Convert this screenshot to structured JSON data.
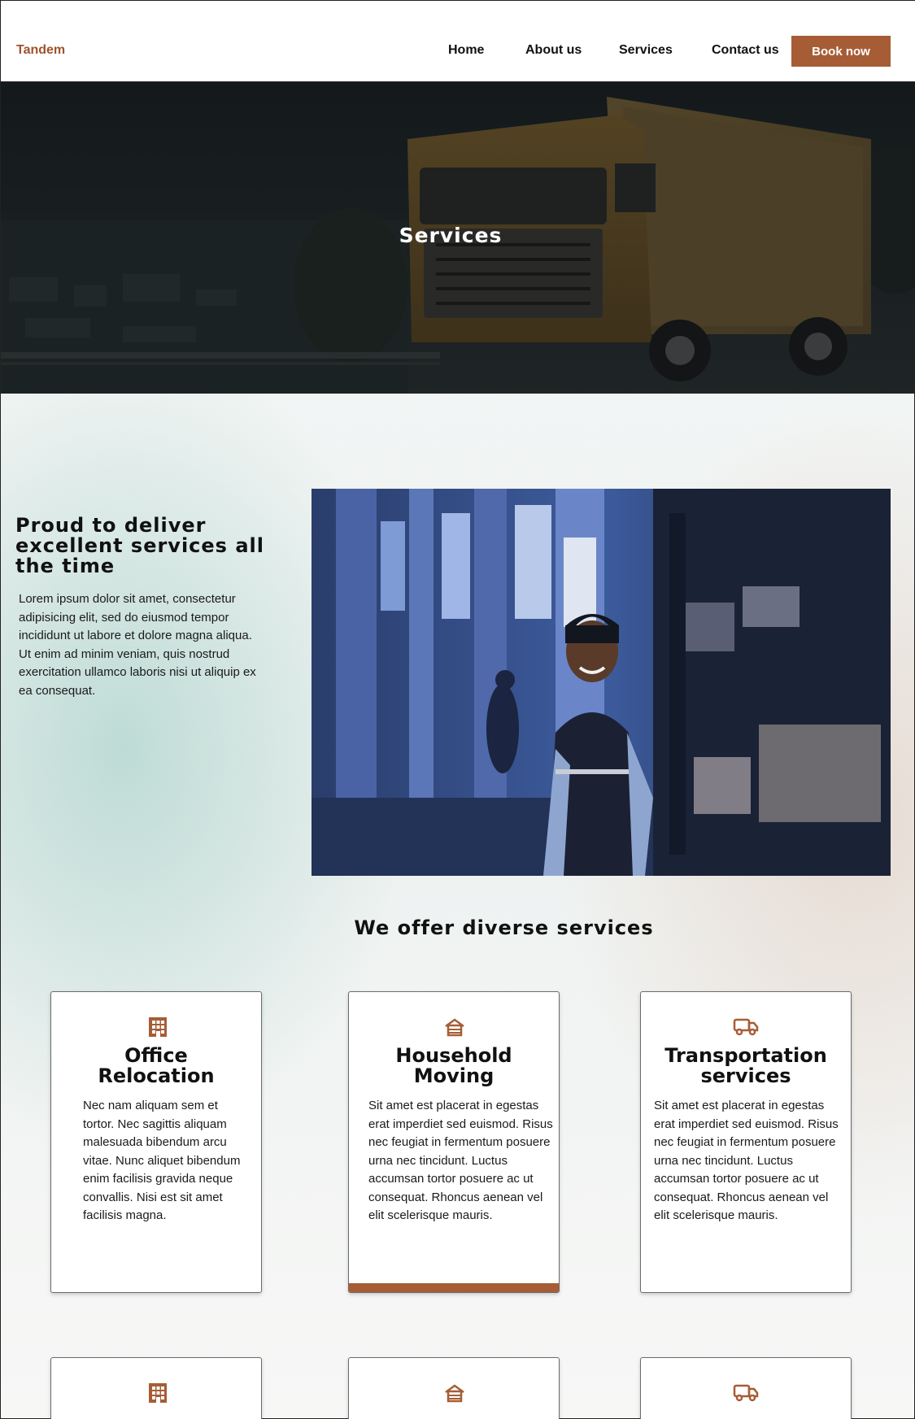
{
  "nav": {
    "brand": "Tandem",
    "links": [
      "Home",
      "About us",
      "Services",
      "Contact us"
    ],
    "cta": "Book now"
  },
  "hero": {
    "title": "Services"
  },
  "intro": {
    "heading": "Proud to deliver excellent services all the time",
    "text": "Lorem ipsum dolor sit amet, consectetur adipisicing elit, sed do eiusmod tempor incididunt ut labore et dolore magna aliqua. Ut enim ad minim veniam, quis nostrud exercitation ullamco laboris nisi ut aliquip ex ea consequat."
  },
  "services": {
    "heading": "We offer diverse services",
    "cards": [
      {
        "icon": "building-icon",
        "title": "Office Relocation",
        "text": "Nec nam aliquam sem et tortor. Nec sagittis aliquam malesuada bibendum arcu vitae. Nunc aliquet bibendum enim facilisis gravida neque convallis. Nisi est sit amet facilisis magna."
      },
      {
        "icon": "house-icon",
        "title": "Household Moving",
        "text": "Sit amet est placerat in egestas erat imperdiet sed euismod. Risus nec feugiat in fermentum posuere urna nec tincidunt. Luctus accumsan tortor posuere ac ut consequat. Rhoncus aenean vel elit scelerisque mauris."
      },
      {
        "icon": "truck-icon",
        "title": "Transportation services",
        "text": "Sit amet est placerat in egestas erat imperdiet sed euismod. Risus nec feugiat in fermentum posuere urna nec tincidunt. Luctus accumsan tortor posuere ac ut consequat. Rhoncus aenean vel elit scelerisque mauris."
      }
    ],
    "row2_icons": [
      "building-icon",
      "house-icon",
      "truck-icon"
    ]
  },
  "colors": {
    "accent": "#a65d35",
    "brand": "#a0522d"
  }
}
